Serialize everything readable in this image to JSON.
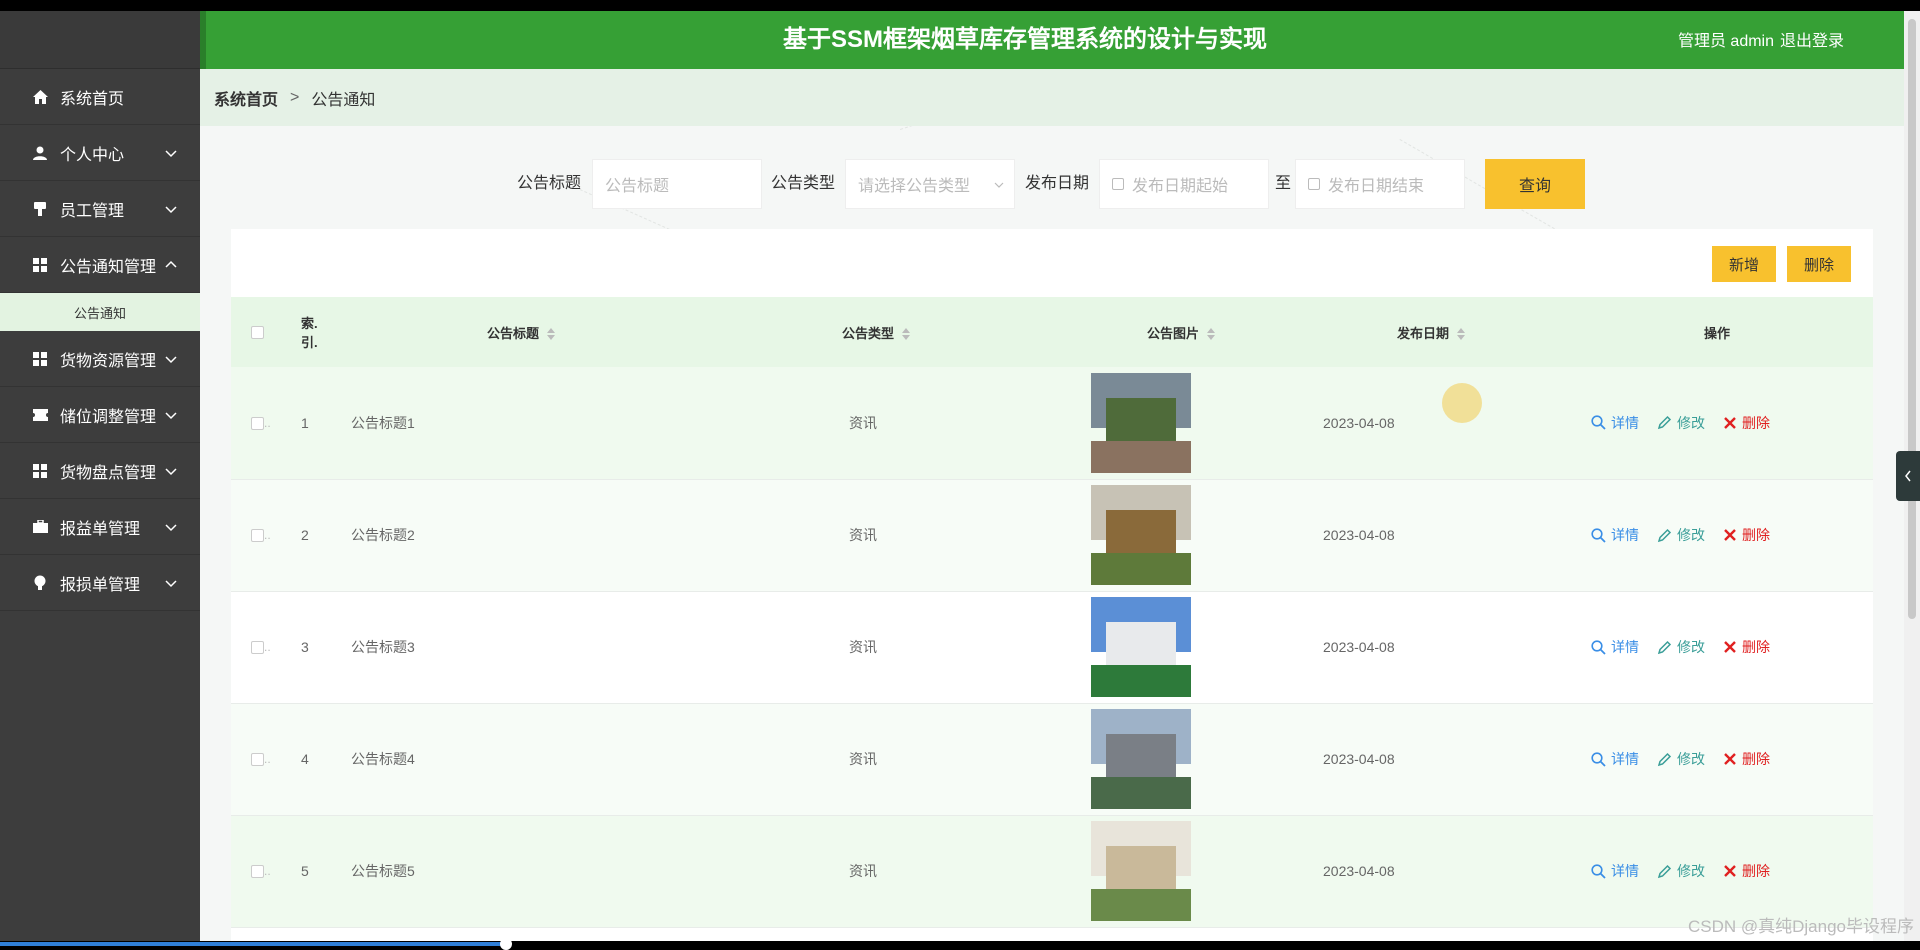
{
  "header": {
    "title": "基于SSM框架烟草库存管理系统的设计与实现",
    "user": "管理员 admin",
    "logout": "退出登录"
  },
  "sidebar": {
    "items": [
      {
        "label": "系统首页",
        "icon": "home-icon",
        "expandable": false
      },
      {
        "label": "个人中心",
        "icon": "user-icon",
        "expandable": true
      },
      {
        "label": "员工管理",
        "icon": "flag-icon",
        "expandable": true
      },
      {
        "label": "公告通知管理",
        "icon": "grid-icon",
        "expandable": true,
        "expanded": true,
        "children": [
          {
            "label": "公告通知"
          }
        ]
      },
      {
        "label": "货物资源管理",
        "icon": "grid-icon",
        "expandable": true
      },
      {
        "label": "储位调整管理",
        "icon": "ticket-icon",
        "expandable": true
      },
      {
        "label": "货物盘点管理",
        "icon": "grid-icon",
        "expandable": true
      },
      {
        "label": "报益单管理",
        "icon": "briefcase-icon",
        "expandable": true
      },
      {
        "label": "报损单管理",
        "icon": "bulb-icon",
        "expandable": true
      }
    ]
  },
  "breadcrumb": {
    "home": "系统首页",
    "separator": ">",
    "current": "公告通知"
  },
  "search": {
    "title_label": "公告标题",
    "title_placeholder": "公告标题",
    "type_label": "公告类型",
    "type_placeholder": "请选择公告类型",
    "date_label": "发布日期",
    "date_start_placeholder": "发布日期起始",
    "date_to": "至",
    "date_end_placeholder": "发布日期结束",
    "query_button": "查询"
  },
  "toolbar": {
    "add_button": "新增",
    "delete_button": "删除"
  },
  "table": {
    "columns": [
      "索引",
      "公告标题",
      "公告类型",
      "公告图片",
      "发布日期",
      "操作"
    ],
    "index_header_lines": [
      "索.",
      "引."
    ],
    "checkbox_ellipsis": "..",
    "actions": {
      "detail": "详情",
      "edit": "修改",
      "delete": "删除"
    },
    "rows": [
      {
        "index": "1",
        "title": "公告标题1",
        "type": "资讯",
        "date": "2023-04-08"
      },
      {
        "index": "2",
        "title": "公告标题2",
        "type": "资讯",
        "date": "2023-04-08"
      },
      {
        "index": "3",
        "title": "公告标题3",
        "type": "资讯",
        "date": "2023-04-08"
      },
      {
        "index": "4",
        "title": "公告标题4",
        "type": "资讯",
        "date": "2023-04-08"
      },
      {
        "index": "5",
        "title": "公告标题5",
        "type": "资讯",
        "date": "2023-04-08"
      }
    ]
  },
  "watermark": "CSDN @真纯Django毕设程序",
  "colors": {
    "header": "#36a035",
    "sidebar": "#3d3d3d",
    "accent_button": "#f8c12e",
    "table_header": "#e7f7e6"
  }
}
